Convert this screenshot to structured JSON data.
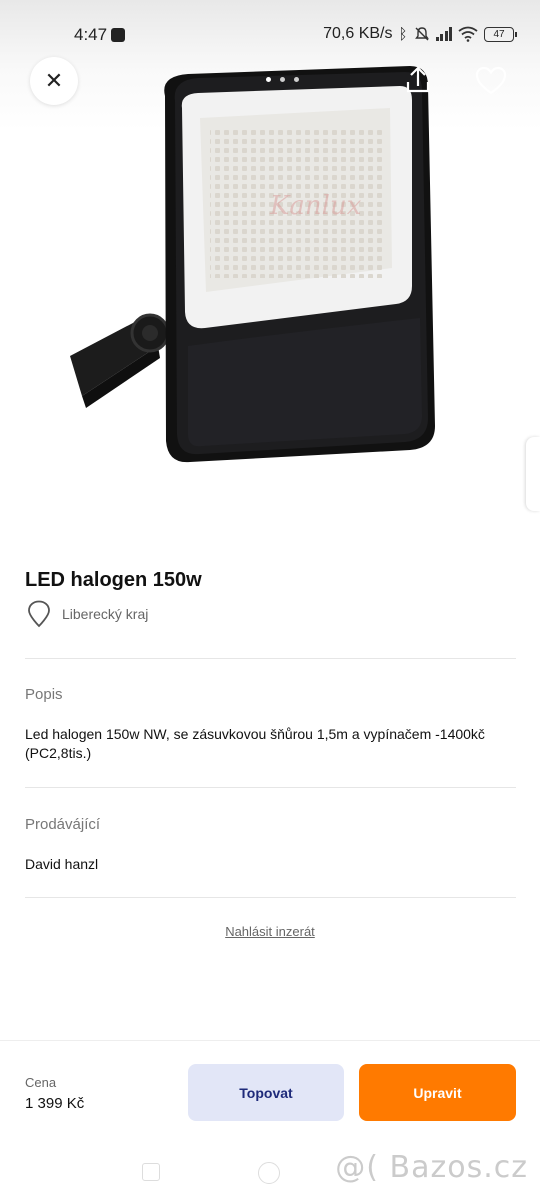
{
  "status_bar": {
    "time": "4:47",
    "network_speed": "70,6 KB/s",
    "battery": "47"
  },
  "gallery": {
    "slide_count": 3,
    "active_slide": 1
  },
  "listing": {
    "title": "LED halogen 150w",
    "location": "Liberecký kraj"
  },
  "description": {
    "heading": "Popis",
    "text": "Led halogen 150w NW, se zásuvkovou šňůrou 1,5m a vypínačem -1400kč (PC2,8tis.)"
  },
  "seller": {
    "heading": "Prodávájící",
    "name": "David hanzl"
  },
  "report_link": "Nahlásit inzerát",
  "bottom": {
    "price_label": "Cena",
    "price": "1 399 Kč",
    "promote_label": "Topovat",
    "edit_label": "Upravit"
  },
  "watermark": "@( Bazos.cz",
  "colors": {
    "accent_orange": "#ff7a00",
    "promote_bg": "#e2e6f7",
    "promote_text": "#1e2a7a"
  }
}
